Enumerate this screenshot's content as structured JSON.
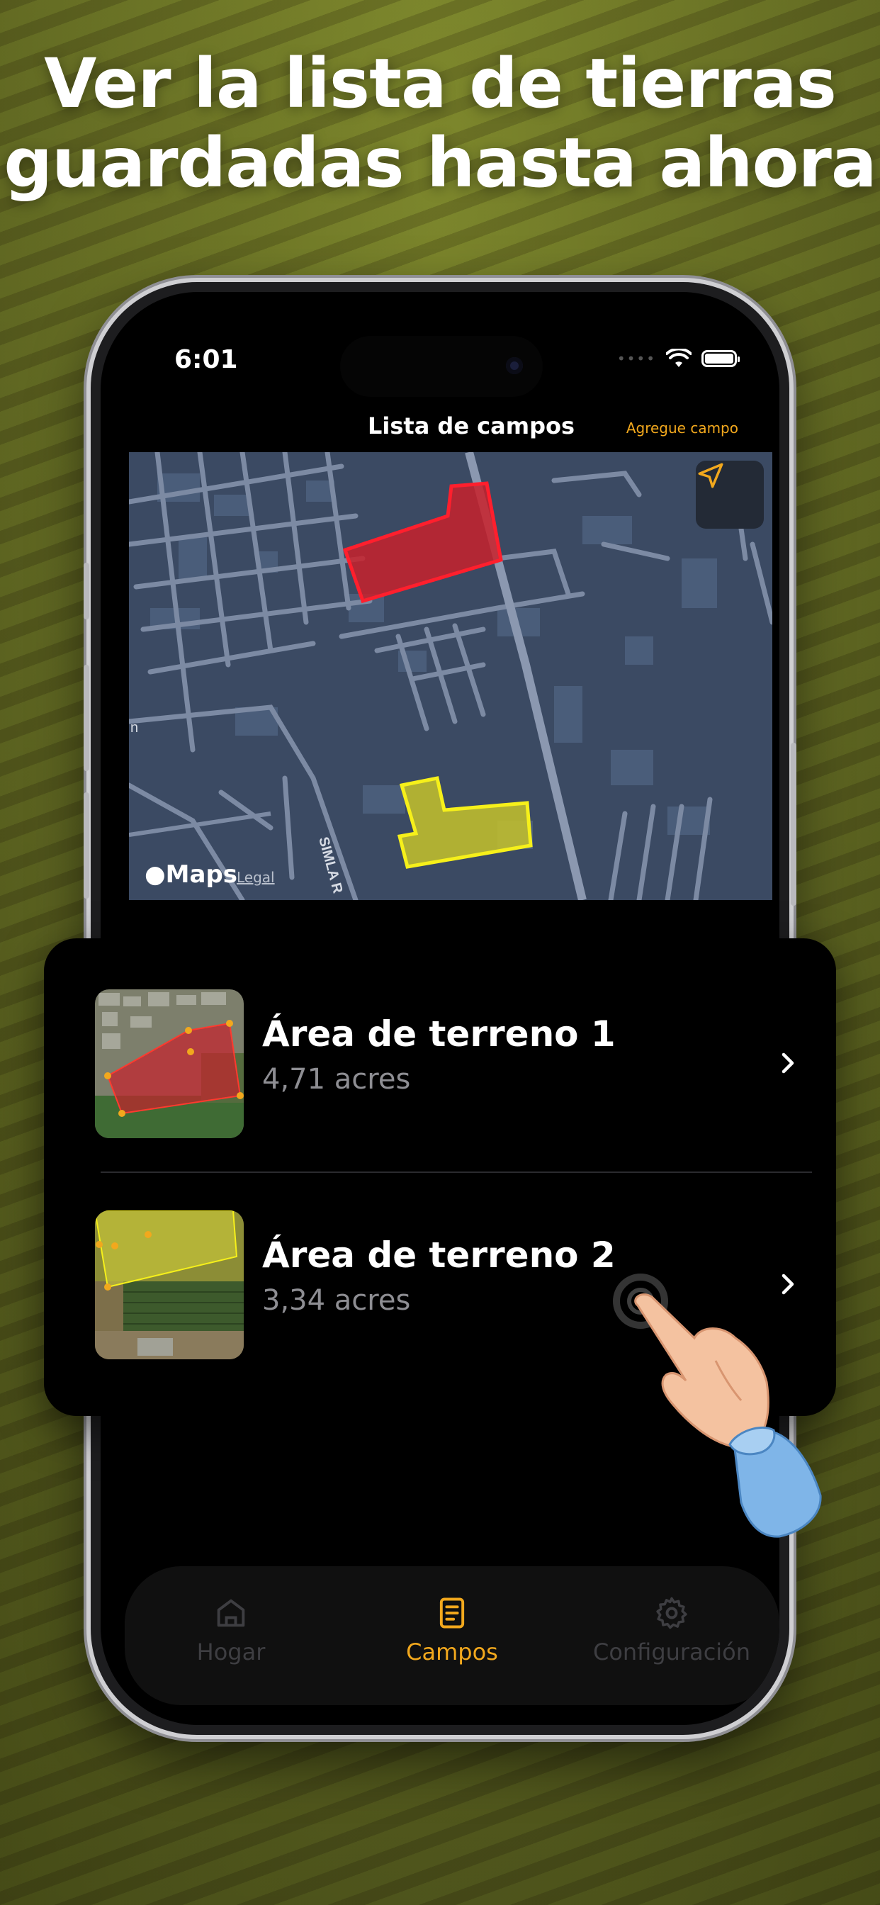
{
  "headline": {
    "line1": "Ver la lista de tierras",
    "line2": "guardadas hasta ahora"
  },
  "status_bar": {
    "time": "6:01"
  },
  "nav": {
    "title": "Lista de campos",
    "action": "Agregue campo"
  },
  "map": {
    "provider_logo": "Maps",
    "legal": "Legal",
    "label_street": "SIMLA R",
    "label_left": "n",
    "locate_icon": "location-arrow-icon",
    "field_colors": {
      "field1": "#c8212c",
      "field2": "#c6c22a"
    }
  },
  "fields": [
    {
      "name": "Área de terreno 1",
      "area": "4,71 acres",
      "color": "#c8212c"
    },
    {
      "name": "Área de terreno 2",
      "area": "3,34 acres",
      "color": "#d6d43a"
    }
  ],
  "tabs": [
    {
      "label": "Hogar",
      "icon": "home-icon",
      "active": false
    },
    {
      "label": "Campos",
      "icon": "document-icon",
      "active": true
    },
    {
      "label": "Configuración",
      "icon": "gear-icon",
      "active": false
    }
  ],
  "colors": {
    "accent": "#f2a81d",
    "background": "#000000"
  }
}
